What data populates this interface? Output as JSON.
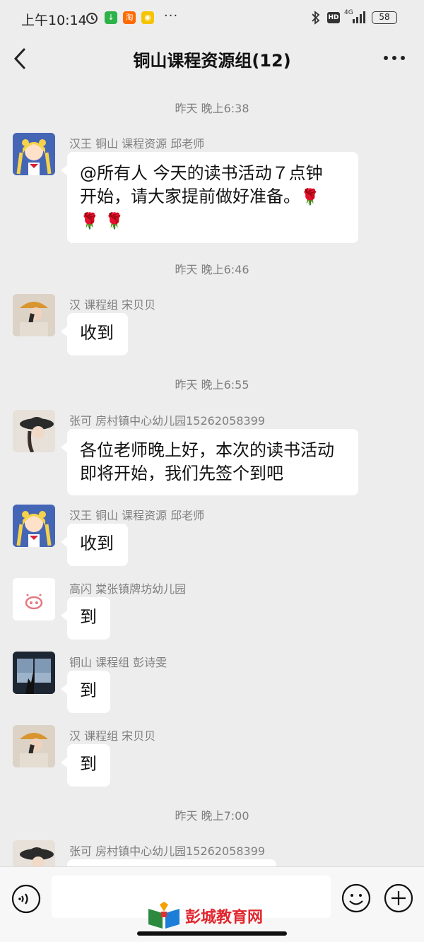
{
  "status_bar": {
    "time": "上午10:14",
    "app_icons": [
      "download-icon",
      "taobao-icon",
      "weibo-icon"
    ],
    "taobao_glyph": "淘",
    "more": "···",
    "network": "4G",
    "hd": "HD",
    "battery": "58"
  },
  "header": {
    "title": "铜山课程资源组(12)"
  },
  "messages": [
    {
      "type": "time",
      "text": "昨天 晚上6:38"
    },
    {
      "type": "msg",
      "sender": "汉王  铜山  课程资源  邱老师",
      "avatar": "anime-girl",
      "line1": "@所有人  今天的读书活动７点钟",
      "line2": "开始，请大家提前做好准备。",
      "line3": ""
    },
    {
      "type": "time",
      "text": "昨天 晚上6:46"
    },
    {
      "type": "msg",
      "sender": "汉  课程组  宋贝贝",
      "avatar": "girl-cap",
      "text": "收到"
    },
    {
      "type": "time",
      "text": "昨天 晚上6:55"
    },
    {
      "type": "msg",
      "sender": "张可  房村镇中心幼儿园15262058399",
      "avatar": "girl-hat",
      "line1": "各位老师晚上好，本次的读书活动",
      "line2": "即将开始，我们先签个到吧"
    },
    {
      "type": "msg",
      "sender": "汉王  铜山  课程资源  邱老师",
      "avatar": "anime-girl",
      "text": "收到"
    },
    {
      "type": "msg",
      "sender": "高闪  棠张镇牌坊幼儿园",
      "avatar": "pig",
      "text": "到"
    },
    {
      "type": "msg",
      "sender": "铜山  课程组  彭诗雯",
      "avatar": "window-silhouette",
      "text": "到"
    },
    {
      "type": "msg",
      "sender": "汉  课程组  宋贝贝",
      "avatar": "girl-cap",
      "text": "到"
    },
    {
      "type": "time",
      "text": "昨天 晚上7:00"
    },
    {
      "type": "msg",
      "sender": "张可  房村镇中心幼儿园15262058399",
      "avatar": "girl-hat",
      "text": ""
    }
  ],
  "input": {
    "placeholder": ""
  },
  "watermark": {
    "text": "彭城教育网"
  },
  "colors": {
    "background": "#ededed",
    "bubble": "#ffffff",
    "rose": "#d9262c",
    "watermark": "#e0262e"
  }
}
